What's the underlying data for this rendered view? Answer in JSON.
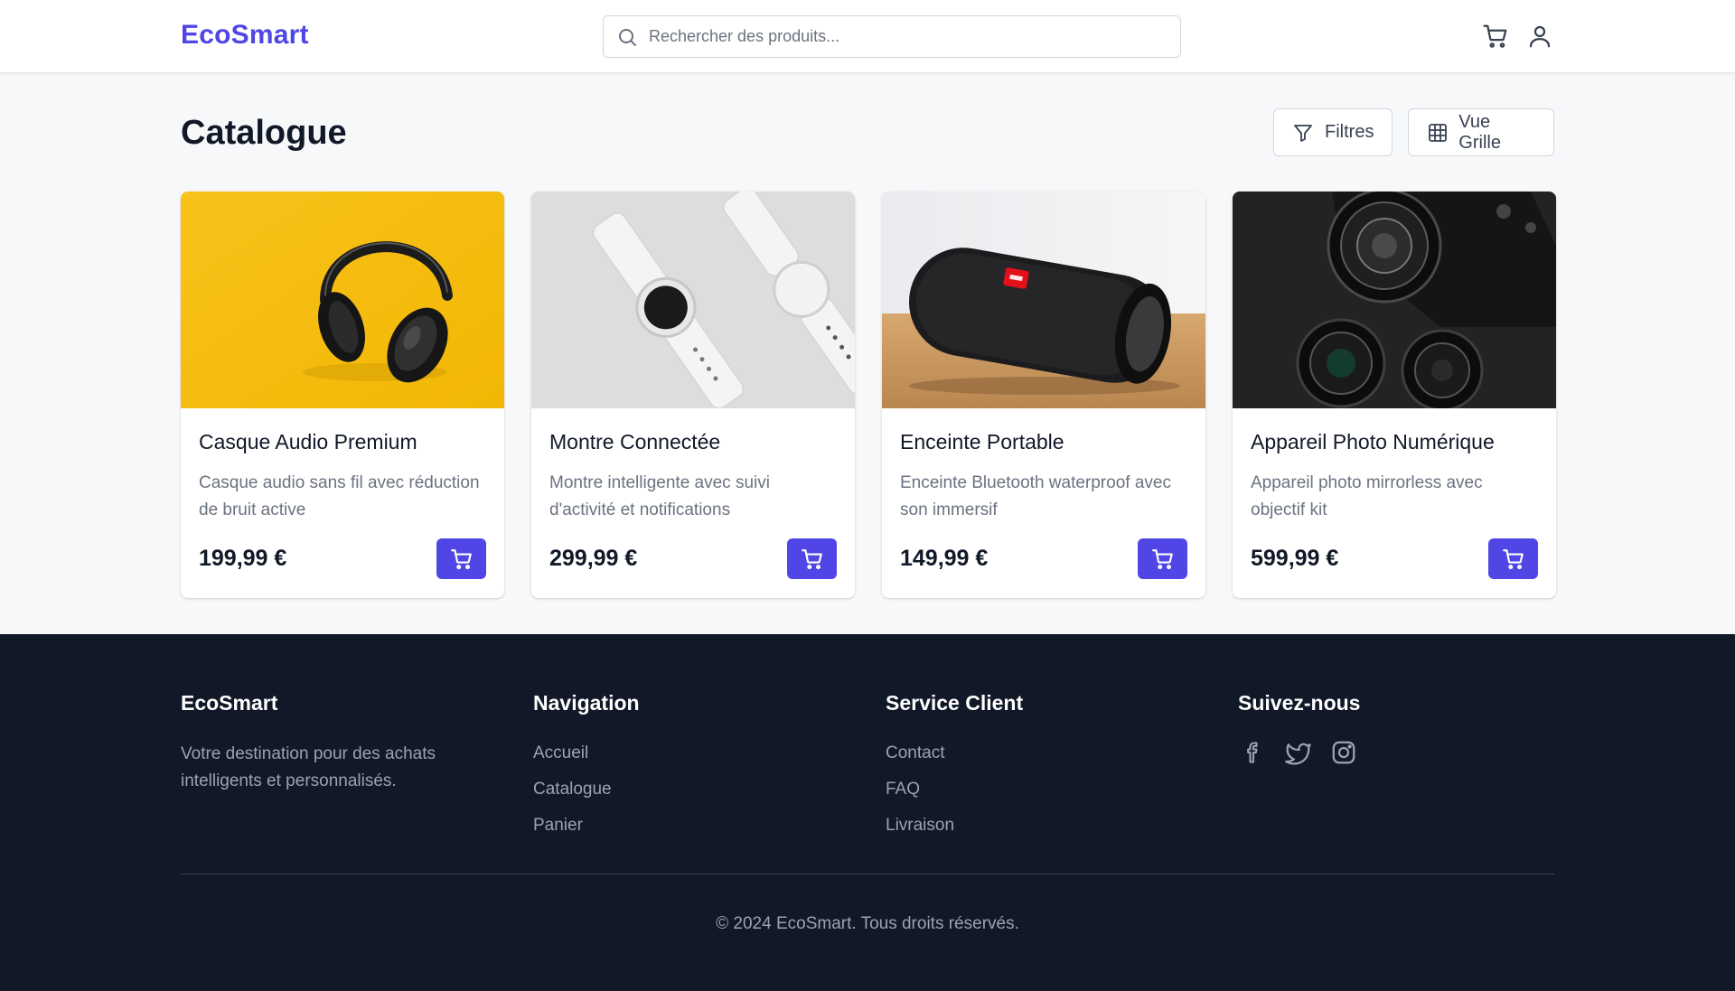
{
  "header": {
    "logo": "EcoSmart",
    "search": {
      "placeholder": "Rechercher des produits..."
    },
    "icons": [
      "cart-icon",
      "user-icon"
    ]
  },
  "main": {
    "title": "Catalogue",
    "filters_label": "Filtres",
    "grid_view_label": "Vue Grille",
    "products": [
      {
        "name": "Casque Audio Premium",
        "description": "Casque audio sans fil avec réduction de bruit active",
        "price": "199,99 €",
        "image": "headphones"
      },
      {
        "name": "Montre Connectée",
        "description": "Montre intelligente avec suivi d'activité et notifications",
        "price": "299,99 €",
        "image": "smartwatch"
      },
      {
        "name": "Enceinte Portable",
        "description": "Enceinte Bluetooth waterproof avec son immersif",
        "price": "149,99 €",
        "image": "speaker"
      },
      {
        "name": "Appareil Photo Numérique",
        "description": "Appareil photo mirrorless avec objectif kit",
        "price": "599,99 €",
        "image": "camera"
      }
    ]
  },
  "footer": {
    "brand": {
      "title": "EcoSmart",
      "text": "Votre destination pour des achats intelligents et personnalisés."
    },
    "navigation": {
      "title": "Navigation",
      "links": [
        "Accueil",
        "Catalogue",
        "Panier"
      ]
    },
    "service": {
      "title": "Service Client",
      "links": [
        "Contact",
        "FAQ",
        "Livraison"
      ]
    },
    "social": {
      "title": "Suivez-nous",
      "icons": [
        "facebook-icon",
        "twitter-icon",
        "instagram-icon"
      ]
    },
    "copyright": "© 2024 EcoSmart. Tous droits réservés."
  },
  "colors": {
    "accent": "#4f46e5",
    "footer_bg": "#111827",
    "page_bg": "#f7f8fa"
  }
}
